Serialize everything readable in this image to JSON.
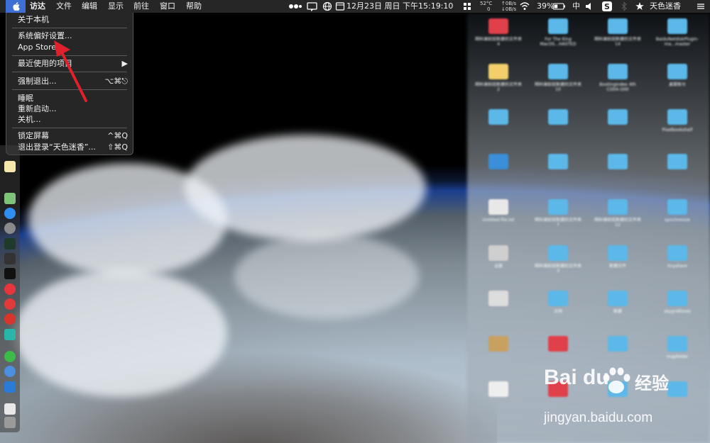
{
  "menubar": {
    "app_menus": [
      "访达",
      "文件",
      "编辑",
      "显示",
      "前往",
      "窗口",
      "帮助"
    ],
    "cpu_temp": "52°C",
    "cpu_load": "0",
    "net_up": "0B/s",
    "net_down": "0B/s",
    "datetime": "12月23日 周日 下午15:19:10",
    "battery": "39%",
    "input_method": "中",
    "user_name": "天色迷香"
  },
  "apple_menu": {
    "about": "关于本机",
    "system_prefs": "系统偏好设置...",
    "app_store": "App Store...",
    "recent_items": "最近使用的项目",
    "recent_arrow": "▶",
    "force_quit": "强制退出...",
    "force_quit_shortcut": "⌥⌘⎋",
    "sleep": "睡眠",
    "restart": "重新启动...",
    "shutdown": "关机...",
    "lock_screen": "锁定屏幕",
    "lock_shortcut": "^⌘Q",
    "logout": "退出登录“天色迷香”...",
    "logout_shortcut": "⇧⌘Q"
  },
  "desktop_icons": [
    {
      "caption": "网科课前班新建的文件夹 4",
      "color": "#e0404a"
    },
    {
      "caption": "For The King MacOS...HASTED",
      "color": "#5bb8e8"
    },
    {
      "caption": "网科课前班新建的文件夹 14",
      "color": "#5bb8e8"
    },
    {
      "caption": "BaiduNetdiskPlugin-ma...master",
      "color": "#5bb8e8"
    },
    {
      "caption": "网科课前班新建的文件夹 2",
      "color": "#f2cf6a"
    },
    {
      "caption": "网科课前班新建的文件夹 10",
      "color": "#5bb8e8"
    },
    {
      "caption": "Bootingindex 4th CO04-O00",
      "color": "#5bb8e8"
    },
    {
      "caption": "桌面账号",
      "color": "#5bb8e8"
    },
    {
      "caption": "",
      "color": "#5bb8e8"
    },
    {
      "caption": "",
      "color": "#5bb8e8"
    },
    {
      "caption": "",
      "color": "#5bb8e8"
    },
    {
      "caption": "Pixelbookshelf",
      "color": "#5bb8e8"
    },
    {
      "caption": "",
      "color": "#3a8fd8"
    },
    {
      "caption": "",
      "color": "#5bb8e8"
    },
    {
      "caption": "",
      "color": "#5bb8e8"
    },
    {
      "caption": "",
      "color": "#5bb8e8"
    },
    {
      "caption": "Untitled file.txt",
      "color": "#e8e8e8"
    },
    {
      "caption": "网科课前班新建的文件夹 7",
      "color": "#5bb8e8"
    },
    {
      "caption": "网科课前班新建的文件夹 12",
      "color": "#5bb8e8"
    },
    {
      "caption": "synchronize",
      "color": "#5bb8e8"
    },
    {
      "caption": "设置",
      "color": "#cfcfcf"
    },
    {
      "caption": "网科课前班新建的文件夹 3",
      "color": "#5bb8e8"
    },
    {
      "caption": "新建文件",
      "color": "#5bb8e8"
    },
    {
      "caption": "tinyshare",
      "color": "#5bb8e8"
    },
    {
      "caption": "",
      "color": "#dddddd"
    },
    {
      "caption": "文档",
      "color": "#5bb8e8"
    },
    {
      "caption": "新建",
      "color": "#5bb8e8"
    },
    {
      "caption": "skygridlimes",
      "color": "#5bb8e8"
    },
    {
      "caption": "",
      "color": "#c8a060"
    },
    {
      "caption": "",
      "color": "#e0404a"
    },
    {
      "caption": "",
      "color": "#5bb8e8"
    },
    {
      "caption": "mapfolder",
      "color": "#5bb8e8"
    },
    {
      "caption": "",
      "color": "#eeeeee"
    },
    {
      "caption": "",
      "color": "#e0404a"
    },
    {
      "caption": "",
      "color": "#5bb8e8"
    },
    {
      "caption": "",
      "color": "#5bb8e8"
    }
  ],
  "watermark": {
    "brand": "Bai du",
    "cn": "经验",
    "url": "jingyan.baidu.com"
  },
  "colors": {
    "menubar_bg": "#262626",
    "apple_highlight": "#3d6fd6",
    "arrow": "#e0212b"
  }
}
